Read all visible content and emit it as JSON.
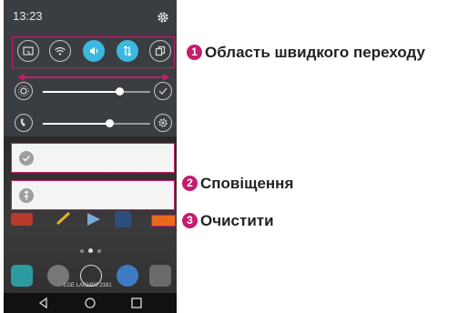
{
  "status_bar": {
    "time": "13:23",
    "settings_icon": "gear-icon"
  },
  "quick_settings": {
    "buttons": [
      {
        "name": "screenshot-icon",
        "active": false
      },
      {
        "name": "wifi-icon",
        "active": false
      },
      {
        "name": "sound-icon",
        "active": true
      },
      {
        "name": "data-icon",
        "active": true
      },
      {
        "name": "more-icon",
        "active": false
      }
    ]
  },
  "sliders": [
    {
      "name": "brightness",
      "value": 0.72,
      "lead_icon": "brightness-icon",
      "tail_icon": "check-circle-icon"
    },
    {
      "name": "volume",
      "value": 0.62,
      "lead_icon": "ringtone-icon",
      "tail_icon": "gear-icon"
    }
  ],
  "notifications": [
    {
      "icon": "check-icon"
    },
    {
      "icon": "usb-icon"
    }
  ],
  "home": {
    "watermark": "LGE LA02400 2181"
  },
  "callouts": [
    {
      "number": "1",
      "text": "Область швидкого переходу"
    },
    {
      "number": "2",
      "text": "Сповіщення"
    },
    {
      "number": "3",
      "text": "Очистити"
    }
  ],
  "colors": {
    "accent": "#c51d6e",
    "toggle_on": "#3bb8e0",
    "clear_button": "#e96a1d"
  }
}
